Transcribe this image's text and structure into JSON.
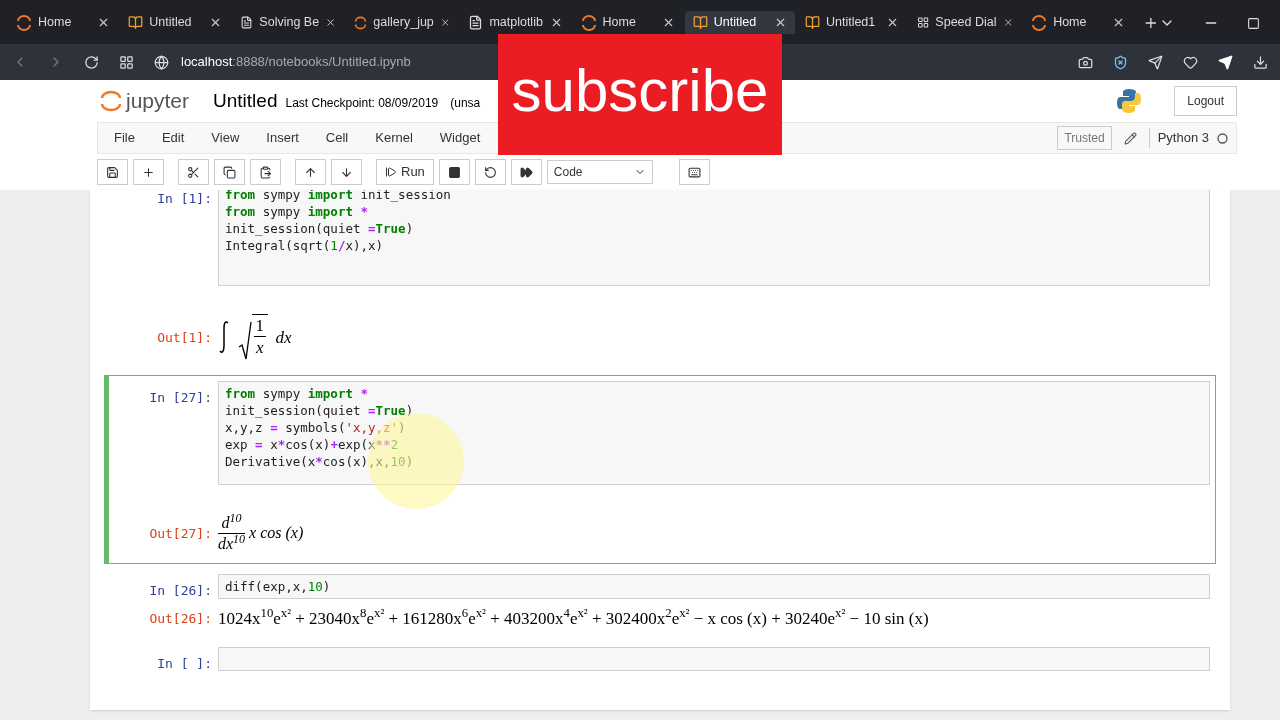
{
  "browser": {
    "tabs": [
      {
        "title": "Home",
        "kind": "jupyter",
        "selected": false
      },
      {
        "title": "Untitled",
        "kind": "book",
        "selected": false
      },
      {
        "title": "Solving Be",
        "kind": "doc",
        "selected": false
      },
      {
        "title": "gallery_jup",
        "kind": "jupyter",
        "selected": false
      },
      {
        "title": "matplotlib",
        "kind": "doc",
        "selected": false
      },
      {
        "title": "Home",
        "kind": "jupyter",
        "selected": false
      },
      {
        "title": "Untitled",
        "kind": "book",
        "selected": true
      },
      {
        "title": "Untitled1",
        "kind": "book",
        "selected": false
      },
      {
        "title": "Speed Dial",
        "kind": "grid",
        "selected": false
      },
      {
        "title": "Home",
        "kind": "jupyter",
        "selected": false
      }
    ],
    "address": {
      "host": "localhost",
      "rest": ":8888/notebooks/Untitled.ipynb"
    }
  },
  "header": {
    "logo": "jupyter",
    "title": "Untitled",
    "checkpoint": "Last Checkpoint: 08/09/2019",
    "status": "(unsa",
    "logout": "Logout"
  },
  "menu": [
    "File",
    "Edit",
    "View",
    "Insert",
    "Cell",
    "Kernel",
    "Widget"
  ],
  "trusted": "Trusted",
  "kernel": "Python 3",
  "toolbar": {
    "run": "Run",
    "cell_type": "Code"
  },
  "overlay": {
    "text": "subscribe"
  },
  "cells": [
    {
      "prompt": "In [1]:",
      "selected": false,
      "lines": [
        [
          {
            "t": "from",
            "kind": "kw"
          },
          {
            "t": " sympy ",
            "kind": "plain"
          },
          {
            "t": "import",
            "kind": "kw"
          },
          {
            "t": " init_session",
            "kind": "plain"
          }
        ],
        [
          {
            "t": "from",
            "kind": "kw"
          },
          {
            "t": " sympy ",
            "kind": "plain"
          },
          {
            "t": "import",
            "kind": "kw"
          },
          {
            "t": " *",
            "kind": "op"
          }
        ],
        [
          {
            "t": "init_session(quiet ",
            "kind": "plain"
          },
          {
            "t": "=",
            "kind": "op"
          },
          {
            "t": "True",
            "kind": "kw"
          },
          {
            "t": ")",
            "kind": "plain"
          }
        ],
        [
          {
            "t": "Integral(sqrt(",
            "kind": "plain"
          },
          {
            "t": "1",
            "kind": "num"
          },
          {
            "t": "/",
            "kind": "op"
          },
          {
            "t": "x),x)",
            "kind": "plain"
          }
        ]
      ],
      "output": {
        "prompt": "Out[1]:",
        "kind": "integral",
        "numerator": "1",
        "denominator": "x",
        "differential": "dx"
      }
    },
    {
      "prompt": "In [27]:",
      "selected": true,
      "lines": [
        [
          {
            "t": "from",
            "kind": "kw"
          },
          {
            "t": " sympy ",
            "kind": "plain"
          },
          {
            "t": "import",
            "kind": "kw"
          },
          {
            "t": " *",
            "kind": "op"
          }
        ],
        [
          {
            "t": "init_session(quiet ",
            "kind": "plain"
          },
          {
            "t": "=",
            "kind": "op"
          },
          {
            "t": "True",
            "kind": "kw"
          },
          {
            "t": ")",
            "kind": "plain"
          }
        ],
        [
          {
            "t": "x,y,z ",
            "kind": "plain"
          },
          {
            "t": "=",
            "kind": "op"
          },
          {
            "t": " symbols(",
            "kind": "plain"
          },
          {
            "t": "'x,y,z'",
            "kind": "str"
          },
          {
            "t": ")",
            "kind": "plain"
          }
        ],
        [
          {
            "t": "exp ",
            "kind": "plain"
          },
          {
            "t": "=",
            "kind": "op"
          },
          {
            "t": " x",
            "kind": "plain"
          },
          {
            "t": "*",
            "kind": "op"
          },
          {
            "t": "cos(x)",
            "kind": "plain"
          },
          {
            "t": "+",
            "kind": "op"
          },
          {
            "t": "exp(x",
            "kind": "plain"
          },
          {
            "t": "**",
            "kind": "op"
          },
          {
            "t": "2",
            "kind": "num"
          }
        ],
        [
          {
            "t": "Derivative(x",
            "kind": "plain"
          },
          {
            "t": "*",
            "kind": "op"
          },
          {
            "t": "cos(x),x,",
            "kind": "plain"
          },
          {
            "t": "10",
            "kind": "num"
          },
          {
            "t": ")",
            "kind": "plain"
          }
        ]
      ],
      "output": {
        "prompt": "Out[27]:",
        "kind": "derivative",
        "numerator": "d$^{10}$",
        "denominator": "dx$^{10}$",
        "expr": "x cos (x)"
      }
    },
    {
      "prompt": "In [26]:",
      "selected": false,
      "lines": [
        [
          {
            "t": "diff(exp,x,",
            "kind": "plain"
          },
          {
            "t": "10",
            "kind": "num"
          },
          {
            "t": ")",
            "kind": "plain"
          }
        ]
      ],
      "output": {
        "prompt": "Out[26]:",
        "kind": "expression",
        "text": "1024x$^{10}$e$^{x²}$ + 23040x$^{8}$e$^{x²}$ + 161280x$^{6}$e$^{x²}$ + 403200x$^{4}$e$^{x²}$ + 302400x$^{2}$e$^{x²}$ − x cos (x) + 30240e$^{x²}$ − 10 sin (x)"
      }
    },
    {
      "prompt": "In [ ]:",
      "selected": false
    }
  ]
}
